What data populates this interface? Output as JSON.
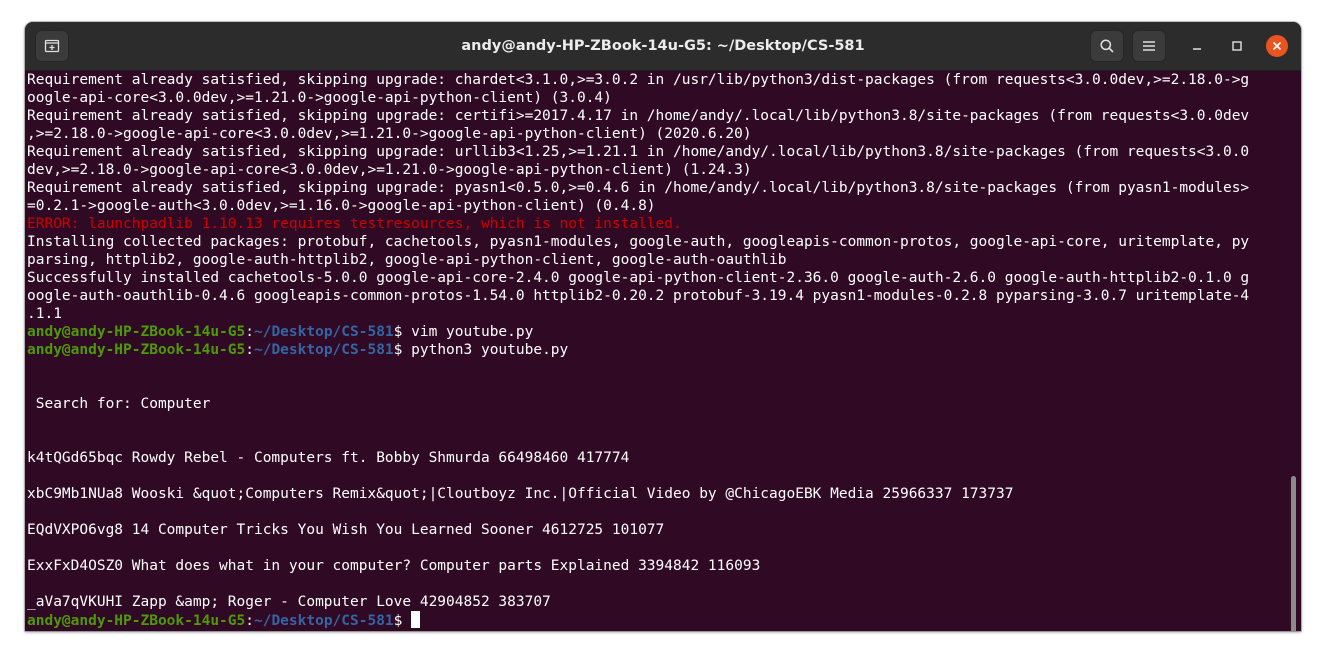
{
  "window": {
    "title": "andy@andy-HP-ZBook-14u-G5: ~/Desktop/CS-581"
  },
  "colors": {
    "terminal_bg": "#300a24",
    "titlebar_bg": "#2c2c2c",
    "prompt_user": "#4e9a06",
    "prompt_path": "#3465a4",
    "error": "#cc0000",
    "close_button": "#e95420"
  },
  "icons": {
    "new_tab": "new-tab-icon",
    "search": "search-icon",
    "menu": "hamburger-menu-icon",
    "minimize": "minimize-icon",
    "maximize": "maximize-icon",
    "close": "close-icon"
  },
  "terminal": {
    "lines": [
      "Requirement already satisfied, skipping upgrade: chardet<3.1.0,>=3.0.2 in /usr/lib/python3/dist-packages (from requests<3.0.0dev,>=2.18.0->g",
      "oogle-api-core<3.0.0dev,>=1.21.0->google-api-python-client) (3.0.4)",
      "Requirement already satisfied, skipping upgrade: certifi>=2017.4.17 in /home/andy/.local/lib/python3.8/site-packages (from requests<3.0.0dev",
      ",>=2.18.0->google-api-core<3.0.0dev,>=1.21.0->google-api-python-client) (2020.6.20)",
      "Requirement already satisfied, skipping upgrade: urllib3<1.25,>=1.21.1 in /home/andy/.local/lib/python3.8/site-packages (from requests<3.0.0",
      "dev,>=2.18.0->google-api-core<3.0.0dev,>=1.21.0->google-api-python-client) (1.24.3)",
      "Requirement already satisfied, skipping upgrade: pyasn1<0.5.0,>=0.4.6 in /home/andy/.local/lib/python3.8/site-packages (from pyasn1-modules>",
      "=0.2.1->google-auth<3.0.0dev,>=1.16.0->google-api-python-client) (0.4.8)"
    ],
    "error_line": "ERROR: launchpadlib 1.10.13 requires testresources, which is not installed.",
    "install_lines": [
      "Installing collected packages: protobuf, cachetools, pyasn1-modules, google-auth, googleapis-common-protos, google-api-core, uritemplate, py",
      "parsing, httplib2, google-auth-httplib2, google-api-python-client, google-auth-oauthlib",
      "Successfully installed cachetools-5.0.0 google-api-core-2.4.0 google-api-python-client-2.36.0 google-auth-2.6.0 google-auth-httplib2-0.1.0 g",
      "oogle-auth-oauthlib-0.4.6 googleapis-common-protos-1.54.0 httplib2-0.20.2 protobuf-3.19.4 pyasn1-modules-0.2.8 pyparsing-3.0.7 uritemplate-4",
      ".1.1"
    ],
    "prompt": {
      "user_host": "andy@andy-HP-ZBook-14u-G5",
      "colon": ":",
      "path": "~/Desktop/CS-581",
      "symbol": "$"
    },
    "commands": [
      " vim youtube.py",
      " python3 youtube.py"
    ],
    "search_line": " Search for: Computer",
    "results": [
      "k4tQGd65bqc Rowdy Rebel - Computers ft. Bobby Shmurda 66498460 417774",
      "xbC9Mb1NUa8 Wooski &quot;Computers Remix&quot;|Cloutboyz Inc.|Official Video by @ChicagoEBK Media 25966337 173737",
      "EQdVXPO6vg8 14 Computer Tricks You Wish You Learned Sooner 4612725 101077",
      "ExxFxD4OSZ0 What does what in your computer? Computer parts Explained 3394842 116093",
      "_aVa7qVKUHI Zapp &amp; Roger - Computer Love 42904852 383707"
    ],
    "final_prompt_suffix": " "
  }
}
